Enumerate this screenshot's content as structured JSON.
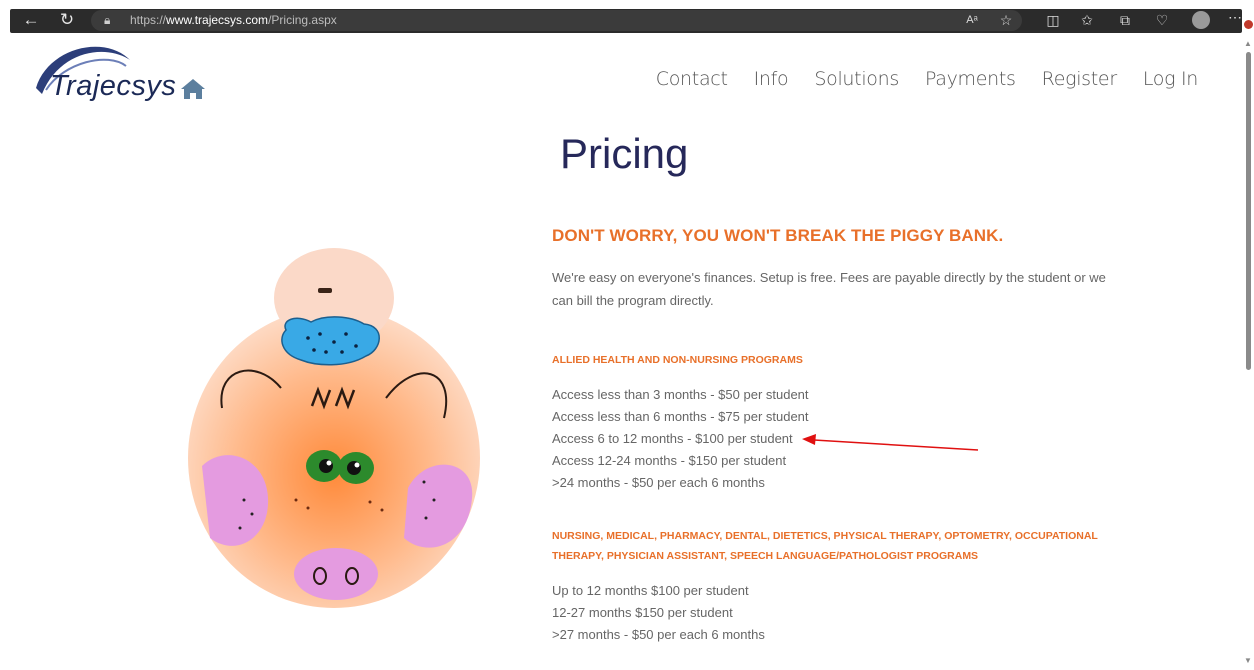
{
  "browser": {
    "url_prefix": "https://",
    "url_host": "www.trajecsys.com",
    "url_path": "/Pricing.aspx"
  },
  "brand": {
    "logo_text": "Trajecsys"
  },
  "nav": {
    "items": [
      {
        "label": "Contact"
      },
      {
        "label": "Info"
      },
      {
        "label": "Solutions"
      },
      {
        "label": "Payments"
      },
      {
        "label": "Register"
      },
      {
        "label": "Log In"
      }
    ]
  },
  "page": {
    "title": "Pricing",
    "headline": "DON'T WORRY, YOU WON'T BREAK THE PIGGY BANK.",
    "intro": "We're easy on everyone's finances. Setup is free. Fees are payable directly by the student or we can bill the program directly.",
    "allied": {
      "heading": "ALLIED HEALTH AND NON-NURSING PROGRAMS",
      "items": [
        "Access less than 3 months - $50 per student",
        "Access less than 6 months - $75 per student",
        "Access 6 to 12 months - $100 per student",
        "Access 12-24 months - $150 per student",
        ">24 months - $50 per each 6 months"
      ]
    },
    "nursing": {
      "heading": "NURSING, MEDICAL, PHARMACY, DENTAL, DIETETICS, PHYSICAL THERAPY, OPTOMETRY, OCCUPATIONAL THERAPY, PHYSICIAN ASSISTANT, SPEECH LANGUAGE/PATHOLOGIST PROGRAMS",
      "items": [
        "Up to 12 months $100 per student",
        "12-27 months $150 per student",
        ">27 months - $50 per each 6 months"
      ]
    }
  },
  "colors": {
    "accent_orange": "#e8702a",
    "title_navy": "#26285a",
    "annotation_red": "#e01010"
  },
  "icons": [
    "back-icon",
    "refresh-icon",
    "lock-icon",
    "read-aloud-icon",
    "favorite-star-icon",
    "split-screen-icon",
    "favorites-list-icon",
    "collections-icon",
    "health-icon",
    "profile-avatar",
    "home-icon",
    "more-icon"
  ]
}
